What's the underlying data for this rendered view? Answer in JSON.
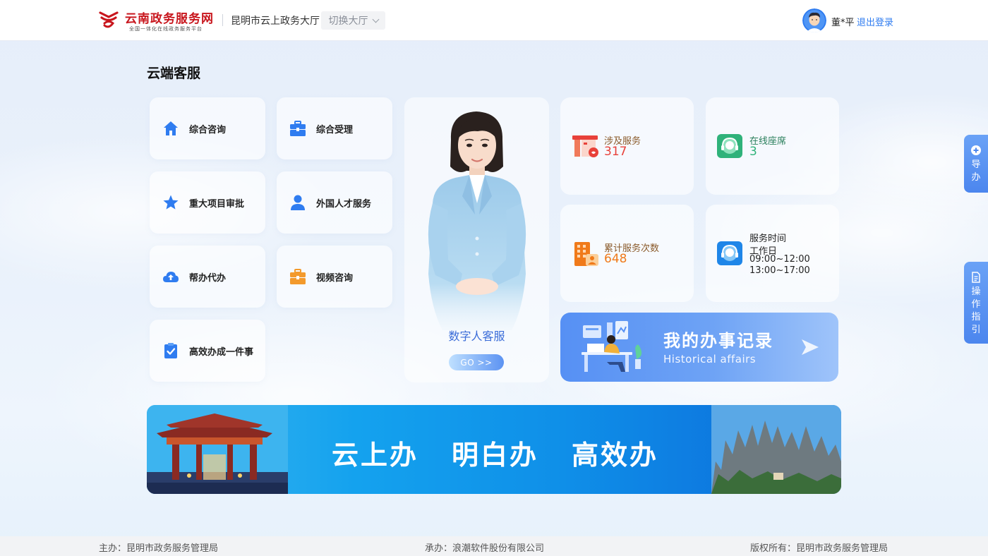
{
  "header": {
    "brand_title": "云南政务服务网",
    "brand_subtitle": "全国一体化在线政务服务平台",
    "hall_name": "昆明市云上政务大厅",
    "switch_label": "切换大厅",
    "user_name": "董*平",
    "logout_label": "退出登录"
  },
  "section_title": "云端客服",
  "menu": [
    {
      "label": "综合咨询",
      "icon": "home-icon"
    },
    {
      "label": "综合受理",
      "icon": "briefcase-icon"
    },
    {
      "label": "重大项目审批",
      "icon": "star-icon"
    },
    {
      "label": "外国人才服务",
      "icon": "person-icon"
    },
    {
      "label": "帮办代办",
      "icon": "cloud-upload-icon"
    },
    {
      "label": "视频咨询",
      "icon": "briefcase-icon"
    },
    {
      "label": "高效办成一件事",
      "icon": "clipboard-check-icon"
    }
  ],
  "digital_human": {
    "label": "数字人客服",
    "go_label": "GO >>"
  },
  "stats": {
    "services": {
      "label": "涉及服务",
      "value": "317"
    },
    "online_seats": {
      "label": "在线座席",
      "value": "3"
    },
    "total_count": {
      "label": "累计服务次数",
      "value": "648"
    },
    "service_time": {
      "label": "服务时间",
      "days": "工作日",
      "morning": "09:00~12:00",
      "afternoon": "13:00~17:00"
    }
  },
  "history": {
    "title_cn": "我的办事记录",
    "title_en": "Historical affairs"
  },
  "slogan": [
    "云上办",
    "明白办",
    "高效办"
  ],
  "side_tabs": [
    {
      "label": [
        "导",
        "办"
      ],
      "icon": "plus-circle-icon"
    },
    {
      "label": [
        "操",
        "作",
        "指",
        "引"
      ],
      "icon": "document-icon"
    }
  ],
  "footer": {
    "host": "主办：昆明市政务服务管理局",
    "undertake": "承办：浪潮软件股份有限公司",
    "copyright": "版权所有：昆明市政务服务管理局"
  },
  "colors": {
    "accent_blue": "#2f7cf0",
    "brand_red": "#c8161d",
    "stat_red": "#e8413a",
    "stat_green": "#2fb27a",
    "stat_orange": "#f07a1a"
  }
}
